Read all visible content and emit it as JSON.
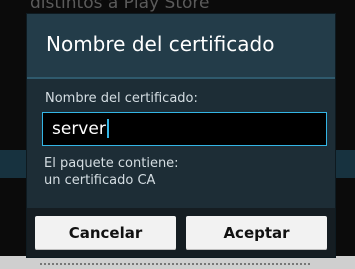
{
  "background": {
    "top_text": "distintos a Play Store"
  },
  "dialog": {
    "title": "Nombre del certificado",
    "field_label": "Nombre del certificado:",
    "field_value": "server",
    "info_line1": "El paquete contiene:",
    "info_line2": "un certificado CA"
  },
  "buttons": {
    "cancel": "Cancelar",
    "accept": "Aceptar"
  },
  "colors": {
    "accent": "#33b5e5",
    "title_bar": "#233c49",
    "dialog_body": "#1d2d36"
  }
}
